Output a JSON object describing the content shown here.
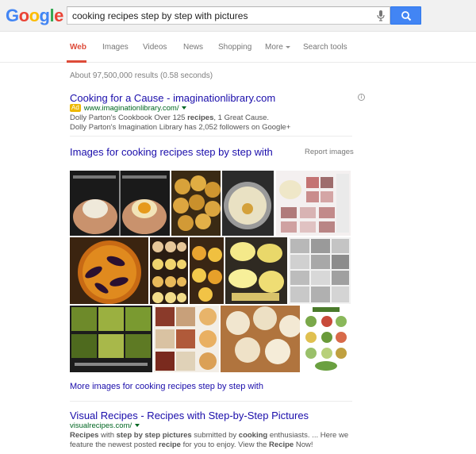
{
  "logo": {
    "letters": [
      "G",
      "o",
      "o",
      "g",
      "l",
      "e"
    ],
    "colors": [
      "#4285f4",
      "#ea4335",
      "#fbbc05",
      "#4285f4",
      "#34a853",
      "#ea4335"
    ]
  },
  "search": {
    "query": "cooking recipes step by step with pictures"
  },
  "tabs": [
    {
      "label": "Web"
    },
    {
      "label": "Images"
    },
    {
      "label": "Videos"
    },
    {
      "label": "News"
    },
    {
      "label": "Shopping"
    },
    {
      "label": "More"
    },
    {
      "label": "Search tools"
    }
  ],
  "stats": "About 97,500,000 results (0.58 seconds)",
  "ad": {
    "title": "Cooking for a Cause - imaginationlibrary.com",
    "badge": "Ad",
    "url": "www.imaginationlibrary.com/",
    "line1_pre": "Dolly Parton's Cookbook Over 125 ",
    "line1_bold": "recipes",
    "line1_post": ", 1 Great Cause.",
    "line2": "Dolly Parton's Imagination Library has 2,052 followers on Google+"
  },
  "images_block": {
    "title": "Images for cooking recipes step by step with",
    "report": "Report images",
    "more": "More images for cooking recipes step by step with"
  },
  "result2": {
    "title": "Visual Recipes - Recipes with Step-by-Step Pictures",
    "url": "visualrecipes.com/",
    "s1": "Recipes",
    "s2": " with ",
    "s3": "step by step pictures",
    "s4": " submitted by ",
    "s5": "cooking",
    "s6": " enthusiasts. ... Here we",
    "s7": "feature the newest posted ",
    "s8": "recipe",
    "s9": " for you to enjoy. View the ",
    "s10": "Recipe",
    "s11": " Now!"
  }
}
